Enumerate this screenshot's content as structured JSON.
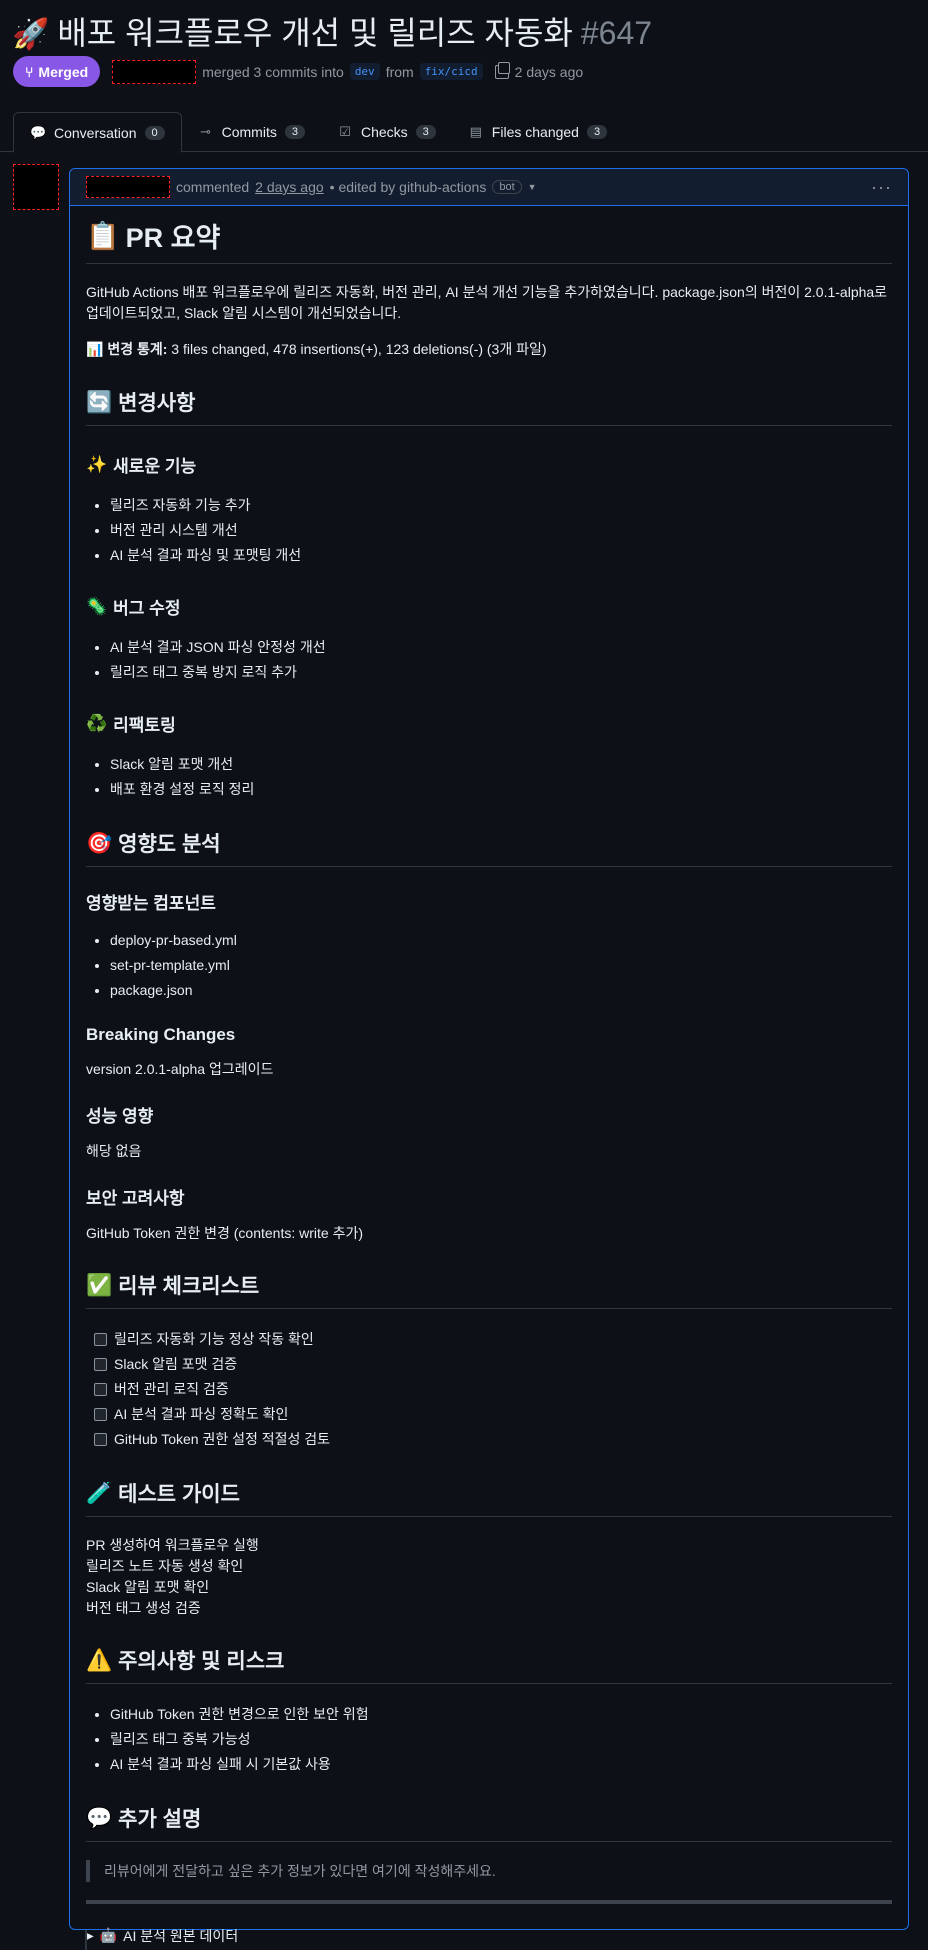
{
  "pr": {
    "title_icon": "🚀",
    "title": "배포 워크플로우 개선 및 릴리즈 자동화",
    "number": "#647",
    "state": "Merged",
    "meta_text": "merged 3 commits into",
    "base_branch": "dev",
    "from_text": "from",
    "head_branch": "fix/cicd",
    "time": "2 days ago"
  },
  "tabs": [
    {
      "label": "Conversation",
      "count": "0",
      "icon": "conversation-icon"
    },
    {
      "label": "Commits",
      "count": "3",
      "icon": "commit-icon"
    },
    {
      "label": "Checks",
      "count": "3",
      "icon": "checklist-icon"
    },
    {
      "label": "Files changed",
      "count": "3",
      "icon": "file-diff-icon"
    }
  ],
  "comment": {
    "action": "commented",
    "time": "2 days ago",
    "edited_by": "• edited by github-actions",
    "bot_label": "bot",
    "more": "···"
  },
  "body": {
    "summary_heading": "PR 요약",
    "summary_icon": "📋",
    "summary_text": "GitHub Actions 배포 워크플로우에 릴리즈 자동화, 버전 관리, AI 분석 개선 기능을 추가하였습니다. package.json의 버전이 2.0.1-alpha로 업데이트되었고, Slack 알림 시스템이 개선되었습니다.",
    "stats_icon": "📊",
    "stats_label": "변경 통계:",
    "stats_text": "3 files changed, 478 insertions(+), 123 deletions(-) (3개 파일)",
    "changes_icon": "🔄",
    "changes_heading": "변경사항",
    "features_icon": "✨",
    "features_heading": "새로운 기능",
    "features": [
      "릴리즈 자동화 기능 추가",
      "버전 관리 시스템 개선",
      "AI 분석 결과 파싱 및 포맷팅 개선"
    ],
    "bugfix_icon": "🦠",
    "bugfix_heading": "버그 수정",
    "bugfixes": [
      "AI 분석 결과 JSON 파싱 안정성 개선",
      "릴리즈 태그 중복 방지 로직 추가"
    ],
    "refactor_icon": "♻️",
    "refactor_heading": "리팩토링",
    "refactors": [
      "Slack 알림 포맷 개선",
      "배포 환경 설정 로직 정리"
    ],
    "impact_icon": "🎯",
    "impact_heading": "영향도 분석",
    "components_heading": "영향받는 컴포넌트",
    "components": [
      "deploy-pr-based.yml",
      "set-pr-template.yml",
      "package.json"
    ],
    "breaking_heading": "Breaking Changes",
    "breaking_text": "version 2.0.1-alpha 업그레이드",
    "perf_heading": "성능 영향",
    "perf_text": "해당 없음",
    "security_heading": "보안 고려사항",
    "security_text": "GitHub Token 권한 변경 (contents: write 추가)",
    "checklist_icon": "✅",
    "checklist_heading": "리뷰 체크리스트",
    "checklist": [
      "릴리즈 자동화 기능 정상 작동 확인",
      "Slack 알림 포맷 검증",
      "버전 관리 로직 검증",
      "AI 분석 결과 파싱 정확도 확인",
      "GitHub Token 권한 설정 적절성 검토"
    ],
    "test_icon": "🧪",
    "test_heading": "테스트 가이드",
    "test_lines": [
      "PR 생성하여 워크플로우 실행",
      "릴리즈 노트 자동 생성 확인",
      "Slack 알림 포맷 확인",
      "버전 태그 생성 검증"
    ],
    "risk_icon": "⚠️",
    "risk_heading": "주의사항 및 리스크",
    "risks": [
      "GitHub Token 권한 변경으로 인한 보안 위험",
      "릴리즈 태그 중복 가능성",
      "AI 분석 결과 파싱 실패 시 기본값 사용"
    ],
    "extra_icon": "💬",
    "extra_heading": "추가 설명",
    "extra_quote": "리뷰어에게 전달하고 싶은 추가 정보가 있다면 여기에 작성해주세요.",
    "details_icon": "🤖",
    "details_label": "AI 분석 원본 데이터"
  },
  "colors": {
    "merged": "#8957e5",
    "accent": "#1f6feb",
    "background": "#0d1117"
  }
}
